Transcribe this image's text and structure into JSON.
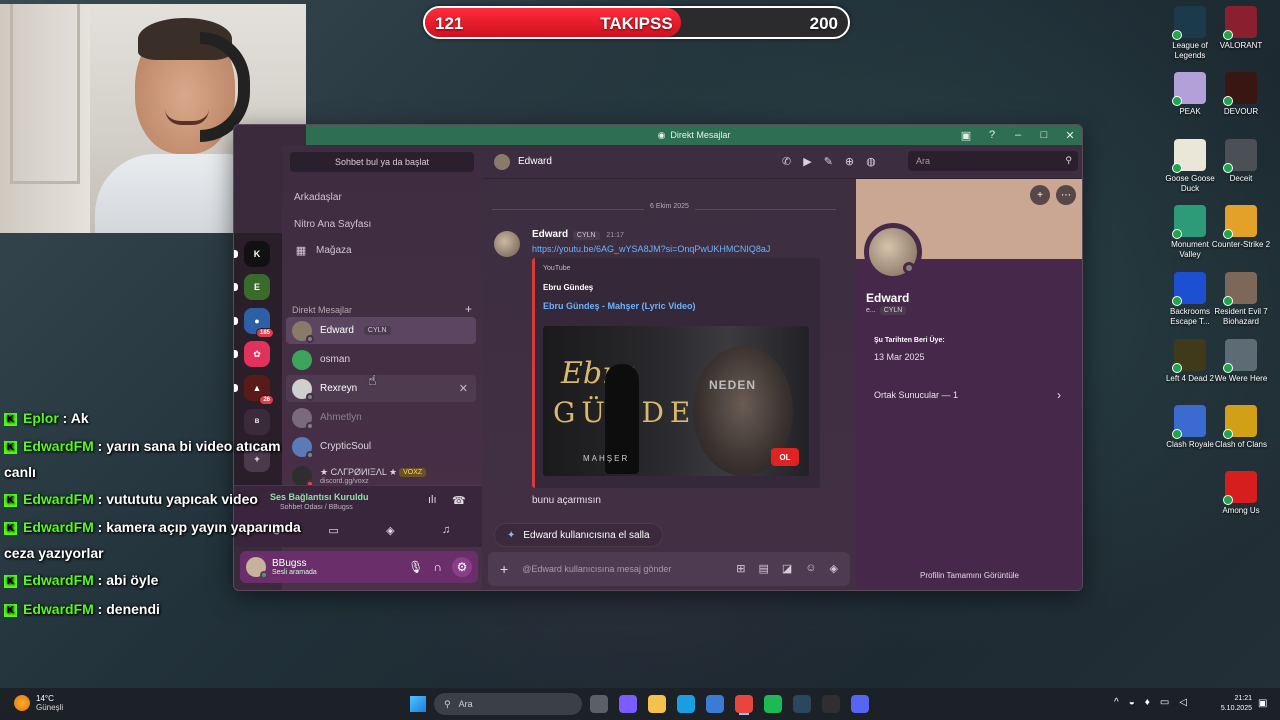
{
  "goal": {
    "current": "121",
    "title": "TAKIPSS",
    "target": "200",
    "progress": 0.605
  },
  "desktop_icons": [
    {
      "label": "League of Legends",
      "icon": "league-of-legends-icon",
      "color": "#1b3b4a"
    },
    {
      "label": "VALORANT",
      "icon": "valorant-icon",
      "color": "#8a1f2f"
    },
    {
      "label": "PEAK",
      "icon": "peak-icon",
      "color": "#b4a0d8"
    },
    {
      "label": "DEVOUR",
      "icon": "devour-icon",
      "color": "#3a1612"
    },
    {
      "label": "Goose Goose Duck",
      "icon": "goose-goose-duck-icon",
      "color": "#eae6d8"
    },
    {
      "label": "Deceit",
      "icon": "deceit-icon",
      "color": "#4b4f56"
    },
    {
      "label": "Monument Valley",
      "icon": "monument-valley-icon",
      "color": "#2d9a78"
    },
    {
      "label": "Counter-Strike 2",
      "icon": "counter-strike-icon",
      "color": "#e3a12a"
    },
    {
      "label": "Backrooms Escape T...",
      "icon": "backrooms-icon",
      "color": "#1c4fd1"
    },
    {
      "label": "Resident Evil 7 Biohazard",
      "icon": "resident-evil-icon",
      "color": "#7d6758"
    },
    {
      "label": "Left 4 Dead 2",
      "icon": "left4dead-icon",
      "color": "#403a1a"
    },
    {
      "label": "We Were Here",
      "icon": "we-were-here-icon",
      "color": "#5d6b75"
    },
    {
      "label": "Clash Royale",
      "icon": "clash-royale-icon",
      "color": "#3b6ad1"
    },
    {
      "label": "Clash of Clans",
      "icon": "clash-of-clans-icon",
      "color": "#d2a017"
    },
    {
      "label": "Among Us",
      "icon": "among-us-icon",
      "color": "#d61e1e"
    }
  ],
  "discord": {
    "window_title": "Direkt Mesajlar",
    "sidebar": {
      "search_placeholder": "Sohbet bul ya da başlat",
      "nav": [
        {
          "label": "Arkadaşlar",
          "icon": "friends-icon"
        },
        {
          "label": "Nitro Ana Sayfası",
          "icon": "nitro-icon"
        },
        {
          "label": "Mağaza",
          "icon": "shop-icon"
        }
      ],
      "dm_header": "Direkt Mesajlar",
      "dms": [
        {
          "name": "Edward",
          "tag": "CYLN",
          "color": "#8a7a6a",
          "status": "#808080"
        },
        {
          "name": "osman",
          "tag": "",
          "color": "#3ba55c",
          "status": ""
        },
        {
          "name": "Rexreyn",
          "tag": "",
          "color": "#cfcfcf",
          "status": "#808080"
        },
        {
          "name": "Ahmetlyn",
          "tag": "",
          "color": "#7a6a7c",
          "status": "#808080"
        },
        {
          "name": "CrypticSoul",
          "tag": "",
          "color": "#5b7ab8",
          "status": "#808080"
        },
        {
          "name": "★ CΛΓPØИIΞΛL ★",
          "tag": "VOXZ",
          "sub": "discord.gg/voxz",
          "color": "#2e2e2e",
          "status": "#ed4245"
        }
      ]
    },
    "rail": [
      {
        "label": "K",
        "color": "#111111",
        "badge": ""
      },
      {
        "label": "E",
        "color": "#3a6b2a",
        "badge": ""
      },
      {
        "label": "●",
        "color": "#2d5fa6",
        "badge": "185"
      },
      {
        "label": "✿",
        "color": "#e0325a",
        "badge": ""
      },
      {
        "label": "▲",
        "color": "#5a1a1a",
        "badge": "26"
      },
      {
        "label": "ᴮ",
        "color": "#3a2a3a",
        "badge": ""
      },
      {
        "label": "+",
        "color": "#4a3a4c",
        "badge": ""
      }
    ],
    "voice": {
      "status": "Ses Bağlantısı Kuruldu",
      "room": "Sohbet Odası / BBugss"
    },
    "user": {
      "name": "BBugss",
      "status": "Sesli aramada"
    },
    "chat": {
      "header_name": "Edward",
      "search_placeholder": "Ara",
      "date": "6 Ekim 2025",
      "author": "Edward",
      "author_tag": "CYLN",
      "time": "21:17",
      "link": "https://youtu.be/6AG_wYSA8JM?si=OnqPwUKHMCNIQ8aJ",
      "embed": {
        "provider": "YouTube",
        "author": "Ebru Gündeş",
        "title": "Ebru Gündeş - Mahşer (Lyric Video)",
        "thumb_text_1": "Ebru",
        "thumb_text_2": "GÜNDEŞ",
        "thumb_text_3": "MAHŞER",
        "thumb_text_4": "NEDEN",
        "thumb_badge": "OL"
      },
      "message": "bunu açarmısın",
      "wave": "Edward kullanıcısına el salla",
      "composer_placeholder": "@Edward kullanıcısına mesaj gönder"
    },
    "profile": {
      "name": "Edward",
      "username": "e...",
      "tag": "CYLN",
      "member_since_label": "Şu Tarihten Beri Üye:",
      "member_since": "13 Mar 2025",
      "mutual_servers": "Ortak Sunucular — 1",
      "view_full": "Profilin Tamamını Görüntüle"
    }
  },
  "stream_chat": [
    {
      "user": "Eplor",
      "text": "Ak"
    },
    {
      "user": "EdwardFM",
      "text": "yarın sana bi video atıcam canlı"
    },
    {
      "user": "EdwardFM",
      "text": "vutututu yapıcak video"
    },
    {
      "user": "EdwardFM",
      "text": "kamera açıp yayın yaparımda ceza yazıyorlar"
    },
    {
      "user": "EdwardFM",
      "text": "abi öyle"
    },
    {
      "user": "EdwardFM",
      "text": "denendi"
    }
  ],
  "taskbar": {
    "weather_temp": "14°C",
    "weather_desc": "Güneşli",
    "search": "Ara",
    "time": "21:21",
    "date": "5.10.2025",
    "apps": [
      {
        "icon": "task-view-icon",
        "color": "#5a5f68"
      },
      {
        "icon": "copilot-icon",
        "color": "#7b5cff"
      },
      {
        "icon": "file-explorer-icon",
        "color": "#f2c14e"
      },
      {
        "icon": "edge-icon",
        "color": "#1b9de2"
      },
      {
        "icon": "store-icon",
        "color": "#3a7bd5"
      },
      {
        "icon": "chrome-icon",
        "color": "#e8453c"
      },
      {
        "icon": "spotify-icon",
        "color": "#1db954"
      },
      {
        "icon": "steam-icon",
        "color": "#2a475e"
      },
      {
        "icon": "obs-icon",
        "color": "#302e31"
      },
      {
        "icon": "discord-icon",
        "color": "#5865f2"
      }
    ]
  }
}
